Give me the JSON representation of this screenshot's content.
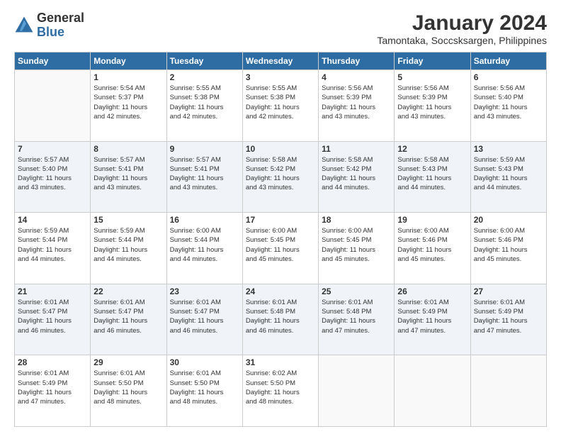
{
  "logo": {
    "line1": "General",
    "line2": "Blue"
  },
  "title": "January 2024",
  "subtitle": "Tamontaka, Soccsksargen, Philippines",
  "columns": [
    "Sunday",
    "Monday",
    "Tuesday",
    "Wednesday",
    "Thursday",
    "Friday",
    "Saturday"
  ],
  "weeks": [
    [
      {
        "day": "",
        "info": ""
      },
      {
        "day": "1",
        "info": "Sunrise: 5:54 AM\nSunset: 5:37 PM\nDaylight: 11 hours\nand 42 minutes."
      },
      {
        "day": "2",
        "info": "Sunrise: 5:55 AM\nSunset: 5:38 PM\nDaylight: 11 hours\nand 42 minutes."
      },
      {
        "day": "3",
        "info": "Sunrise: 5:55 AM\nSunset: 5:38 PM\nDaylight: 11 hours\nand 42 minutes."
      },
      {
        "day": "4",
        "info": "Sunrise: 5:56 AM\nSunset: 5:39 PM\nDaylight: 11 hours\nand 43 minutes."
      },
      {
        "day": "5",
        "info": "Sunrise: 5:56 AM\nSunset: 5:39 PM\nDaylight: 11 hours\nand 43 minutes."
      },
      {
        "day": "6",
        "info": "Sunrise: 5:56 AM\nSunset: 5:40 PM\nDaylight: 11 hours\nand 43 minutes."
      }
    ],
    [
      {
        "day": "7",
        "info": "Sunrise: 5:57 AM\nSunset: 5:40 PM\nDaylight: 11 hours\nand 43 minutes."
      },
      {
        "day": "8",
        "info": "Sunrise: 5:57 AM\nSunset: 5:41 PM\nDaylight: 11 hours\nand 43 minutes."
      },
      {
        "day": "9",
        "info": "Sunrise: 5:57 AM\nSunset: 5:41 PM\nDaylight: 11 hours\nand 43 minutes."
      },
      {
        "day": "10",
        "info": "Sunrise: 5:58 AM\nSunset: 5:42 PM\nDaylight: 11 hours\nand 43 minutes."
      },
      {
        "day": "11",
        "info": "Sunrise: 5:58 AM\nSunset: 5:42 PM\nDaylight: 11 hours\nand 44 minutes."
      },
      {
        "day": "12",
        "info": "Sunrise: 5:58 AM\nSunset: 5:43 PM\nDaylight: 11 hours\nand 44 minutes."
      },
      {
        "day": "13",
        "info": "Sunrise: 5:59 AM\nSunset: 5:43 PM\nDaylight: 11 hours\nand 44 minutes."
      }
    ],
    [
      {
        "day": "14",
        "info": "Sunrise: 5:59 AM\nSunset: 5:44 PM\nDaylight: 11 hours\nand 44 minutes."
      },
      {
        "day": "15",
        "info": "Sunrise: 5:59 AM\nSunset: 5:44 PM\nDaylight: 11 hours\nand 44 minutes."
      },
      {
        "day": "16",
        "info": "Sunrise: 6:00 AM\nSunset: 5:44 PM\nDaylight: 11 hours\nand 44 minutes."
      },
      {
        "day": "17",
        "info": "Sunrise: 6:00 AM\nSunset: 5:45 PM\nDaylight: 11 hours\nand 45 minutes."
      },
      {
        "day": "18",
        "info": "Sunrise: 6:00 AM\nSunset: 5:45 PM\nDaylight: 11 hours\nand 45 minutes."
      },
      {
        "day": "19",
        "info": "Sunrise: 6:00 AM\nSunset: 5:46 PM\nDaylight: 11 hours\nand 45 minutes."
      },
      {
        "day": "20",
        "info": "Sunrise: 6:00 AM\nSunset: 5:46 PM\nDaylight: 11 hours\nand 45 minutes."
      }
    ],
    [
      {
        "day": "21",
        "info": "Sunrise: 6:01 AM\nSunset: 5:47 PM\nDaylight: 11 hours\nand 46 minutes."
      },
      {
        "day": "22",
        "info": "Sunrise: 6:01 AM\nSunset: 5:47 PM\nDaylight: 11 hours\nand 46 minutes."
      },
      {
        "day": "23",
        "info": "Sunrise: 6:01 AM\nSunset: 5:47 PM\nDaylight: 11 hours\nand 46 minutes."
      },
      {
        "day": "24",
        "info": "Sunrise: 6:01 AM\nSunset: 5:48 PM\nDaylight: 11 hours\nand 46 minutes."
      },
      {
        "day": "25",
        "info": "Sunrise: 6:01 AM\nSunset: 5:48 PM\nDaylight: 11 hours\nand 47 minutes."
      },
      {
        "day": "26",
        "info": "Sunrise: 6:01 AM\nSunset: 5:49 PM\nDaylight: 11 hours\nand 47 minutes."
      },
      {
        "day": "27",
        "info": "Sunrise: 6:01 AM\nSunset: 5:49 PM\nDaylight: 11 hours\nand 47 minutes."
      }
    ],
    [
      {
        "day": "28",
        "info": "Sunrise: 6:01 AM\nSunset: 5:49 PM\nDaylight: 11 hours\nand 47 minutes."
      },
      {
        "day": "29",
        "info": "Sunrise: 6:01 AM\nSunset: 5:50 PM\nDaylight: 11 hours\nand 48 minutes."
      },
      {
        "day": "30",
        "info": "Sunrise: 6:01 AM\nSunset: 5:50 PM\nDaylight: 11 hours\nand 48 minutes."
      },
      {
        "day": "31",
        "info": "Sunrise: 6:02 AM\nSunset: 5:50 PM\nDaylight: 11 hours\nand 48 minutes."
      },
      {
        "day": "",
        "info": ""
      },
      {
        "day": "",
        "info": ""
      },
      {
        "day": "",
        "info": ""
      }
    ]
  ]
}
